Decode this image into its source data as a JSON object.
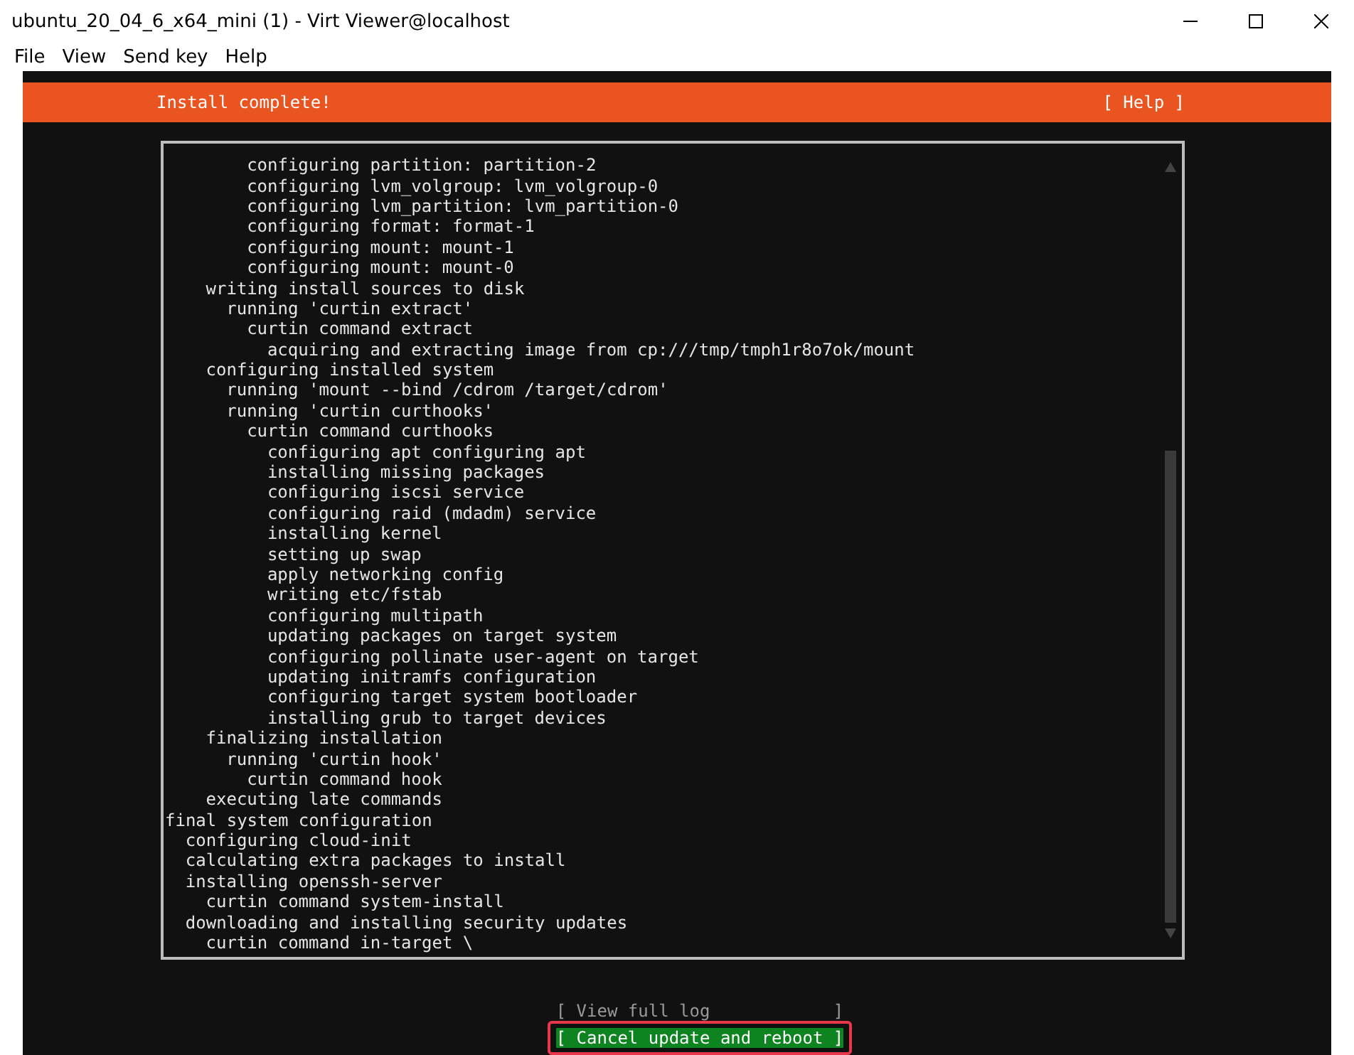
{
  "window": {
    "title": "ubuntu_20_04_6_x64_mini (1) - Virt Viewer@localhost"
  },
  "menu": [
    {
      "label": "File"
    },
    {
      "label": "View"
    },
    {
      "label": "Send key"
    },
    {
      "label": "Help"
    }
  ],
  "header": {
    "title": "Install complete!",
    "help": "[ Help ]"
  },
  "log": [
    {
      "children": [
        {
          "children": [
            {
              "children": [
                {
                  "children": [
                    {
                      "text": "configuring partition: partition-2"
                    },
                    {
                      "text": "configuring lvm_volgroup: lvm_volgroup-0"
                    },
                    {
                      "text": "configuring lvm_partition: lvm_partition-0"
                    },
                    {
                      "text": "configuring format: format-1"
                    },
                    {
                      "text": "configuring mount: mount-1"
                    },
                    {
                      "text": "configuring mount: mount-0"
                    }
                  ]
                }
              ]
            },
            {
              "text": "writing install sources to disk",
              "children": [
                {
                  "text": "running 'curtin extract'",
                  "children": [
                    {
                      "text": "curtin command extract",
                      "children": [
                        {
                          "text": "acquiring and extracting image from cp:///tmp/tmph1r8o7ok/mount"
                        }
                      ]
                    }
                  ]
                }
              ]
            },
            {
              "text": "configuring installed system",
              "children": [
                {
                  "text": "running 'mount --bind /cdrom /target/cdrom'"
                },
                {
                  "text": "running 'curtin curthooks'",
                  "children": [
                    {
                      "text": "curtin command curthooks",
                      "children": [
                        {
                          "text": "configuring apt configuring apt"
                        },
                        {
                          "text": "installing missing packages"
                        },
                        {
                          "text": "configuring iscsi service"
                        },
                        {
                          "text": "configuring raid (mdadm) service"
                        },
                        {
                          "text": "installing kernel"
                        },
                        {
                          "text": "setting up swap"
                        },
                        {
                          "text": "apply networking config"
                        },
                        {
                          "text": "writing etc/fstab"
                        },
                        {
                          "text": "configuring multipath"
                        },
                        {
                          "text": "updating packages on target system"
                        },
                        {
                          "text": "configuring pollinate user-agent on target"
                        },
                        {
                          "text": "updating initramfs configuration"
                        },
                        {
                          "text": "configuring target system bootloader"
                        },
                        {
                          "text": "installing grub to target devices"
                        }
                      ]
                    }
                  ]
                }
              ]
            },
            {
              "text": "finalizing installation",
              "children": [
                {
                  "text": "running 'curtin hook'",
                  "children": [
                    {
                      "text": "curtin command hook"
                    }
                  ]
                }
              ]
            },
            {
              "text": "executing late commands"
            }
          ]
        }
      ]
    },
    {
      "text": "final system configuration",
      "children": [
        {
          "text": "configuring cloud-init"
        },
        {
          "text": "calculating extra packages to install"
        },
        {
          "text": "installing openssh-server",
          "children": [
            {
              "text": "curtin command system-install"
            }
          ]
        },
        {
          "text": "downloading and installing security updates",
          "children": [
            {
              "text": "curtin command in-target \\"
            }
          ]
        }
      ]
    }
  ],
  "buttons": [
    {
      "label": "[ View full log            ]",
      "selected": false,
      "disabled": true,
      "highlighted": false
    },
    {
      "label": "[ Cancel update and reboot ]",
      "selected": true,
      "disabled": false,
      "highlighted": true
    }
  ]
}
